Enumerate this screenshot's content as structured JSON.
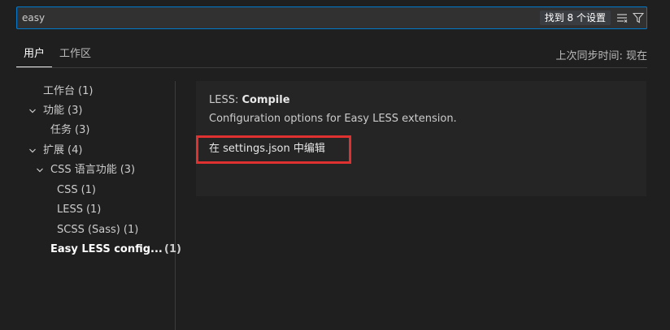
{
  "search": {
    "value": "easy",
    "result_badge": "找到 8 个设置",
    "icons": {
      "clear_filter": "list-filter-icon",
      "filter": "funnel-icon"
    }
  },
  "tabs": [
    {
      "label": "用户",
      "active": true
    },
    {
      "label": "工作区",
      "active": false
    }
  ],
  "sync_status": "上次同步时间: 现在",
  "tree": [
    {
      "label": "工作台",
      "count": "(1)"
    },
    {
      "label": "功能",
      "count": "(3)",
      "chevron": "chevron-down-icon"
    },
    {
      "label": "任务",
      "count": "(3)"
    },
    {
      "label": "扩展",
      "count": "(4)",
      "chevron": "chevron-down-icon"
    },
    {
      "label": "CSS 语言功能",
      "count": "(3)",
      "chevron": "chevron-down-icon"
    },
    {
      "label": "CSS",
      "count": "(1)"
    },
    {
      "label": "LESS",
      "count": "(1)"
    },
    {
      "label": "SCSS (Sass)",
      "count": "(1)"
    },
    {
      "label": "Easy LESS config...",
      "count": "(1)",
      "selected": true
    }
  ],
  "setting": {
    "title_prefix": "LESS: ",
    "title_name": "Compile",
    "description": "Configuration options for Easy LESS extension.",
    "edit_link": "在 settings.json 中编辑"
  },
  "colors": {
    "background": "#1f1f1f",
    "accent_border": "#007acc",
    "highlight_box": "#e03131"
  }
}
